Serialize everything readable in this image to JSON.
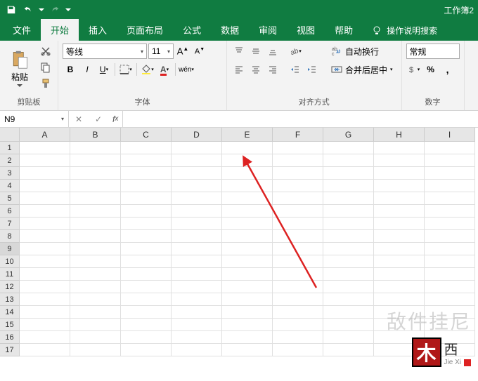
{
  "title": "工作簿2",
  "qat": {
    "save": "保存",
    "undo": "撤销",
    "redo": "重做"
  },
  "tabs": [
    {
      "label": "文件"
    },
    {
      "label": "开始",
      "active": true
    },
    {
      "label": "插入"
    },
    {
      "label": "页面布局"
    },
    {
      "label": "公式"
    },
    {
      "label": "数据"
    },
    {
      "label": "审阅"
    },
    {
      "label": "视图"
    },
    {
      "label": "帮助"
    }
  ],
  "tell_me": "操作说明搜索",
  "ribbon": {
    "clipboard": {
      "label": "剪贴板",
      "paste": "粘贴"
    },
    "font": {
      "label": "字体",
      "name": "等线",
      "size": "11",
      "pinyin": "wén"
    },
    "alignment": {
      "label": "对齐方式",
      "wrap": "自动换行",
      "merge": "合并后居中"
    },
    "number": {
      "label": "数字",
      "format": "常规"
    }
  },
  "namebox": "N9",
  "formula": "",
  "columns": [
    "A",
    "B",
    "C",
    "D",
    "E",
    "F",
    "G",
    "H",
    "I"
  ],
  "rows": [
    "1",
    "2",
    "3",
    "4",
    "5",
    "6",
    "7",
    "8",
    "9",
    "10",
    "11",
    "12",
    "13",
    "14",
    "15",
    "16",
    "17"
  ],
  "selected_row": 9,
  "watermark": {
    "text": "敌件挂尼",
    "stamp_main": "木",
    "stamp_side": "西",
    "stamp_sub": "Jie Xi"
  }
}
